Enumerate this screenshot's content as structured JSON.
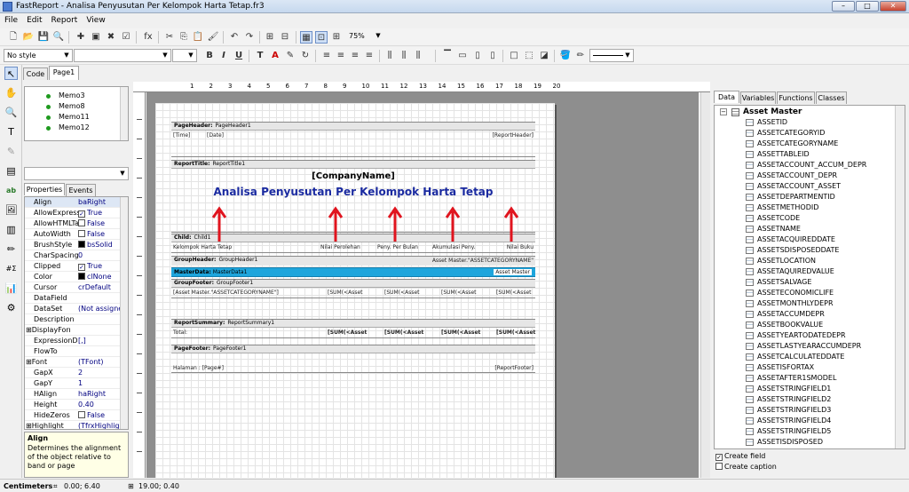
{
  "window": {
    "title": "FastReport - Analisa Penyusutan Per Kelompok Harta Tetap.fr3"
  },
  "menu": [
    "File",
    "Edit",
    "Report",
    "View"
  ],
  "toolbar": {
    "zoom": "75%",
    "style": "No style"
  },
  "tabs": {
    "code": "Code",
    "page": "Page1"
  },
  "tree": [
    "Memo3",
    "Memo8",
    "Memo11",
    "Memo12"
  ],
  "inspector": {
    "tabs": [
      "Properties",
      "Events"
    ],
    "rows": [
      {
        "n": "Align",
        "v": "baRight",
        "t": "text"
      },
      {
        "n": "AllowExpress",
        "v": "True",
        "t": "check",
        "c": true
      },
      {
        "n": "AllowHTMLTa",
        "v": "False",
        "t": "check",
        "c": false
      },
      {
        "n": "AutoWidth",
        "v": "False",
        "t": "check",
        "c": false
      },
      {
        "n": "BrushStyle",
        "v": "bsSolid",
        "t": "color",
        "col": "#000000"
      },
      {
        "n": "CharSpacing",
        "v": "0",
        "t": "text"
      },
      {
        "n": "Clipped",
        "v": "True",
        "t": "check",
        "c": true
      },
      {
        "n": "Color",
        "v": "clNone",
        "t": "color",
        "col": "#000000"
      },
      {
        "n": "Cursor",
        "v": "crDefault",
        "t": "text"
      },
      {
        "n": "DataField",
        "v": "",
        "t": "text"
      },
      {
        "n": "DataSet",
        "v": "(Not assigned",
        "t": "text"
      },
      {
        "n": "Description",
        "v": "",
        "t": "text"
      },
      {
        "n": "DisplayForma",
        "v": "",
        "t": "expand"
      },
      {
        "n": "ExpressionDe",
        "v": "[,]",
        "t": "text"
      },
      {
        "n": "FlowTo",
        "v": "",
        "t": "text"
      },
      {
        "n": "Font",
        "v": "(TFont)",
        "t": "expand"
      },
      {
        "n": "GapX",
        "v": "2",
        "t": "text"
      },
      {
        "n": "GapY",
        "v": "1",
        "t": "text"
      },
      {
        "n": "HAlign",
        "v": "haRight",
        "t": "text"
      },
      {
        "n": "Height",
        "v": "0.40",
        "t": "text"
      },
      {
        "n": "HideZeros",
        "v": "False",
        "t": "check",
        "c": false
      },
      {
        "n": "Highlight",
        "v": "(TfrxHighlight",
        "t": "expand"
      }
    ],
    "hint_title": "Align",
    "hint_text": "Determines the alignment of the object relative to band or page"
  },
  "report": {
    "page_header": {
      "name": "PageHeader:",
      "obj": "PageHeader1",
      "memos": [
        "[Time]",
        "[Date]",
        "[ReportHeader]"
      ]
    },
    "report_title": {
      "name": "ReportTitle:",
      "obj": "ReportTitle1",
      "company": "[CompanyName]",
      "title": "Analisa Penyusutan Per Kelompok Harta Tetap"
    },
    "child": {
      "name": "Child:",
      "obj": "Child1",
      "cols": [
        "Kelompok Harta Tetap",
        "Nilai Perolehan",
        "Peny. Per Bulan",
        "Akumulasi Peny.",
        "Nilai Buku"
      ]
    },
    "group_header": {
      "name": "GroupHeader:",
      "obj": "GroupHeader1",
      "cond": "Asset Master.\"ASSETCATEGORYNAME\""
    },
    "master_data": {
      "name": "MasterData:",
      "obj": "MasterData1",
      "ds": "Asset Master"
    },
    "group_footer": {
      "name": "GroupFooter:",
      "obj": "GroupFooter1",
      "memos": [
        "[Asset Master.\"ASSETCATEGORYNAME\"]",
        "[SUM(<Asset",
        "[SUM(<Asset",
        "[SUM(<Asset",
        "[SUM(<Asset"
      ]
    },
    "report_summary": {
      "name": "ReportSummary:",
      "obj": "ReportSummary1",
      "memos": [
        "Total:",
        "[SUM(<Asset",
        "[SUM(<Asset",
        "[SUM(<Asset",
        "[SUM(<Asset"
      ]
    },
    "page_footer": {
      "name": "PageFooter:",
      "obj": "PageFooter1",
      "memos": [
        "Halaman : [Page#]",
        "[ReportFooter]"
      ]
    }
  },
  "ruler_numbers": [
    "1",
    "2",
    "3",
    "4",
    "5",
    "6",
    "7",
    "8",
    "9",
    "10",
    "11",
    "12",
    "13",
    "14",
    "15",
    "16",
    "17",
    "18",
    "19",
    "20"
  ],
  "data_panel": {
    "tabs": [
      "Data",
      "Variables",
      "Functions",
      "Classes"
    ],
    "root": "Asset Master",
    "fields": [
      "ASSETID",
      "ASSETCATEGORYID",
      "ASSETCATEGORYNAME",
      "ASSETTABLEID",
      "ASSETACCOUNT_ACCUM_DEPR",
      "ASSETACCOUNT_DEPR",
      "ASSETACCOUNT_ASSET",
      "ASSETDEPARTMENTID",
      "ASSETMETHODID",
      "ASSETCODE",
      "ASSETNAME",
      "ASSETACQUIREDDATE",
      "ASSETSDISPOSEDDATE",
      "ASSETLOCATION",
      "ASSETAQUIREDVALUE",
      "ASSETSALVAGE",
      "ASSETECONOMICLIFE",
      "ASSETMONTHLYDEPR",
      "ASSETACCUMDEPR",
      "ASSETBOOKVALUE",
      "ASSETYEARTODATEDEPR",
      "ASSETLASTYEARACCUMDEPR",
      "ASSETCALCULATEDDATE",
      "ASSETISFORTAX",
      "ASSETAFTER1SMODEL",
      "ASSETSTRINGFIELD1",
      "ASSETSTRINGFIELD2",
      "ASSETSTRINGFIELD3",
      "ASSETSTRINGFIELD4",
      "ASSETSTRINGFIELD5",
      "ASSETISDISPOSED"
    ],
    "create_field": "Create field",
    "create_caption": "Create caption"
  },
  "status": {
    "units": "Centimeters",
    "pos": "0.00; 6.40",
    "size": "19.00; 0.40"
  },
  "colors": {
    "masterdata_band": "#1ea5dc",
    "arrow": "#e0141e",
    "title_text": "#1a2aa0"
  }
}
